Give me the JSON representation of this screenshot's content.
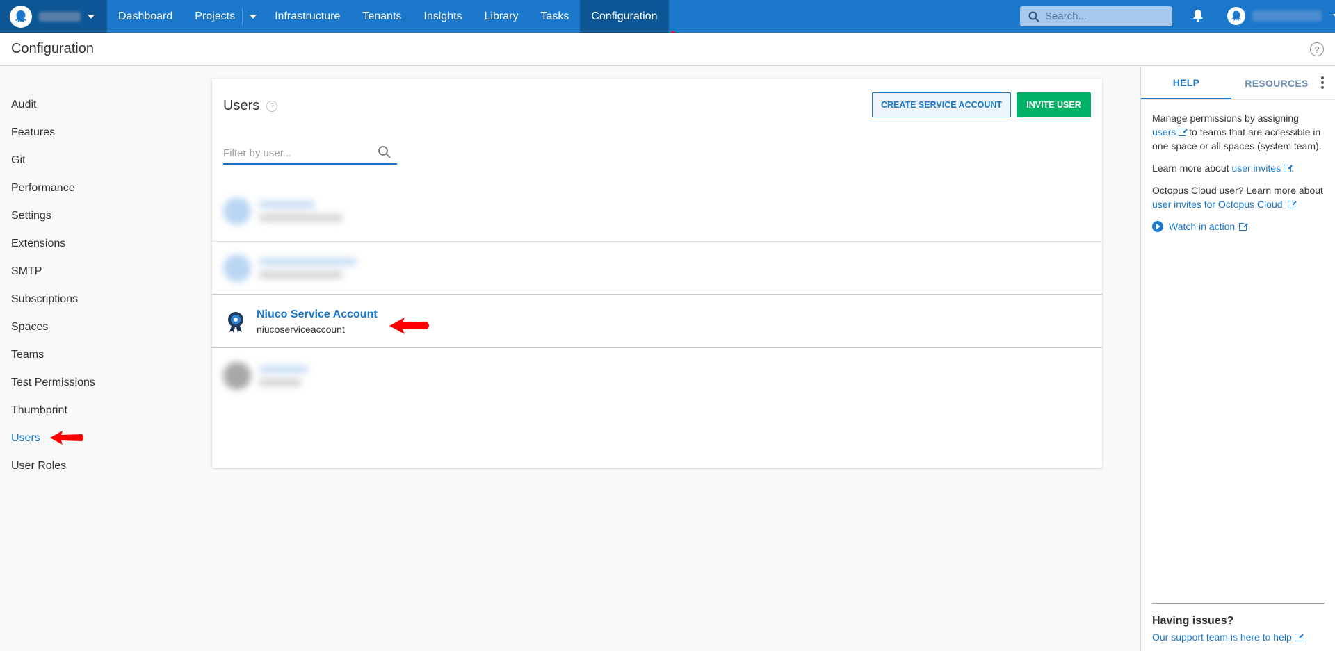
{
  "topnav": {
    "items": [
      "Dashboard",
      "Projects",
      "Infrastructure",
      "Tenants",
      "Insights",
      "Library",
      "Tasks",
      "Configuration"
    ],
    "active": "Configuration",
    "search_placeholder": "Search..."
  },
  "page": {
    "title": "Configuration"
  },
  "sidebar": {
    "items": [
      "Audit",
      "Features",
      "Git",
      "Performance",
      "Settings",
      "Extensions",
      "SMTP",
      "Subscriptions",
      "Spaces",
      "Teams",
      "Test Permissions",
      "Thumbprint",
      "Users",
      "User Roles"
    ],
    "active": "Users"
  },
  "users_card": {
    "title": "Users",
    "create_service_account_label": "CREATE SERVICE ACCOUNT",
    "invite_user_label": "INVITE USER",
    "filter_placeholder": "Filter by user...",
    "service_account": {
      "name": "Niuco Service Account",
      "login": "niucoserviceaccount"
    }
  },
  "help_panel": {
    "tabs": [
      "HELP",
      "RESOURCES"
    ],
    "active_tab": "HELP",
    "p1_pre": "Manage permissions by assigning ",
    "p1_link": "users",
    "p1_post": " to teams that are accessible in one space or all spaces (system team).",
    "p2_pre": "Learn more about ",
    "p2_link": "user invites",
    "p2_post": ".",
    "p3_pre": "Octopus Cloud user? Learn more about ",
    "p3_link": "user invites for Octopus Cloud",
    "watch_label": "Watch in action",
    "footer_title": "Having issues?",
    "footer_link": "Our support team is here to help"
  },
  "colors": {
    "brand": "#1a77ca",
    "brand_dark": "#0d5796",
    "invite_green": "#00b065",
    "annotation_red": "#ff0000"
  }
}
